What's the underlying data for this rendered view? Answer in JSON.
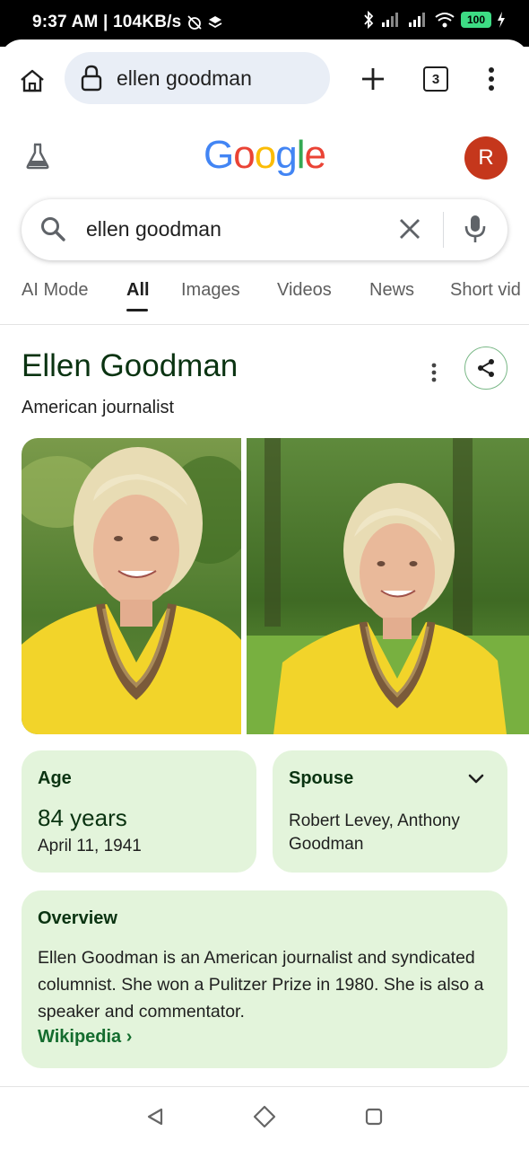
{
  "status_bar": {
    "time_speed": "9:37 AM | 104KB/s",
    "battery": "100"
  },
  "browser": {
    "url": "ellen goodman",
    "tab_count": "3"
  },
  "header": {
    "logo": [
      "G",
      "o",
      "o",
      "g",
      "l",
      "e"
    ],
    "logo_colors": [
      "#4285F4",
      "#EA4335",
      "#FBBC05",
      "#4285F4",
      "#34A853",
      "#EA4335"
    ],
    "avatar_initial": "R",
    "avatar_color": "#c5371c"
  },
  "search": {
    "query": "ellen goodman"
  },
  "tabs": [
    {
      "label": "AI Mode"
    },
    {
      "label": "All"
    },
    {
      "label": "Images"
    },
    {
      "label": "Videos"
    },
    {
      "label": "News"
    },
    {
      "label": "Short vid"
    }
  ],
  "active_tab": "All",
  "knowledge_panel": {
    "title": "Ellen Goodman",
    "subtitle": "American journalist",
    "age": {
      "label": "Age",
      "value": "84 years",
      "date": "April 11, 1941"
    },
    "spouse": {
      "label": "Spouse",
      "value": "Robert Levey, Anthony Goodman"
    },
    "overview": {
      "label": "Overview",
      "text": "Ellen Goodman is an American journalist and syndicated columnist. She won a Pulitzer Prize in 1980. She is also a speaker and commentator.",
      "link": "Wikipedia ›"
    }
  },
  "colors": {
    "accent_green": "#146c2e",
    "card_bg": "#e3f4db",
    "title_green": "#0a3311"
  }
}
